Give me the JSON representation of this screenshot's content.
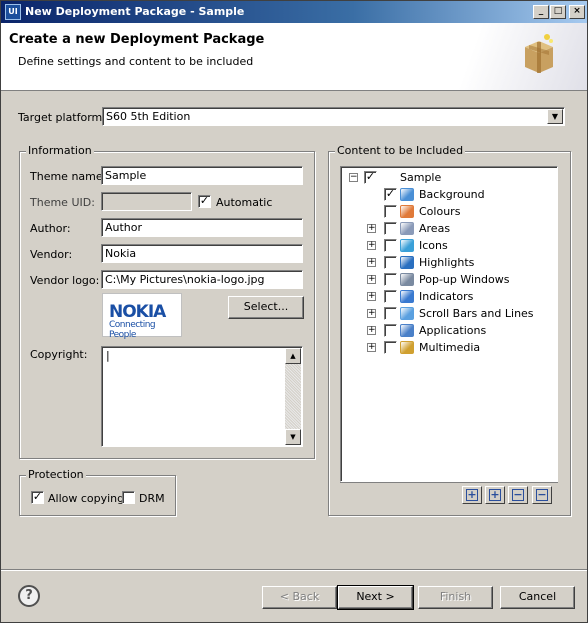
{
  "window": {
    "title": "New Deployment Package - Sample",
    "app_icon_text": "UI",
    "minimize_glyph": "_",
    "maximize_glyph": "□",
    "close_glyph": "×"
  },
  "banner": {
    "title": "Create a new Deployment Package",
    "subtitle": "Define settings and content to be included",
    "icon": "gift-box-icon"
  },
  "target_platform": {
    "label": "Target platform:",
    "value": "S60 5th Edition"
  },
  "information": {
    "group_label": "Information",
    "theme_name_label": "Theme name:",
    "theme_name_value": "Sample",
    "theme_uid_label": "Theme UID:",
    "theme_uid_value": "",
    "automatic_label": "Automatic",
    "automatic_checked": true,
    "author_label": "Author:",
    "author_value": "Author",
    "vendor_label": "Vendor:",
    "vendor_value": "Nokia",
    "vendor_logo_label": "Vendor logo:",
    "vendor_logo_value": "C:\\My Pictures\\nokia-logo.jpg",
    "logo_brand": "NOKIA",
    "logo_tagline": "Connecting People",
    "select_button": "Select...",
    "copyright_label": "Copyright:",
    "copyright_value": "|"
  },
  "protection": {
    "group_label": "Protection",
    "allow_copying_label": "Allow copying",
    "allow_copying_checked": true,
    "drm_label": "DRM",
    "drm_checked": false
  },
  "content": {
    "group_label": "Content to be Included",
    "root": {
      "label": "Sample",
      "checked": true,
      "expanded": true
    },
    "items": [
      {
        "label": "Background",
        "checked": true,
        "expandable": false,
        "icon": "background-icon",
        "color": "#4a8fd6"
      },
      {
        "label": "Colours",
        "checked": false,
        "expandable": false,
        "icon": "palette-icon",
        "color": "#e07a3a"
      },
      {
        "label": "Areas",
        "checked": false,
        "expandable": true,
        "icon": "areas-icon",
        "color": "#8a9ab8"
      },
      {
        "label": "Icons",
        "checked": false,
        "expandable": true,
        "icon": "icons-icon",
        "color": "#3aa0d8"
      },
      {
        "label": "Highlights",
        "checked": false,
        "expandable": true,
        "icon": "highlights-icon",
        "color": "#2a6fc0"
      },
      {
        "label": "Pop-up Windows",
        "checked": false,
        "expandable": true,
        "icon": "popup-icon",
        "color": "#7a8aa0"
      },
      {
        "label": "Indicators",
        "checked": false,
        "expandable": true,
        "icon": "indicators-icon",
        "color": "#3a7ad0"
      },
      {
        "label": "Scroll Bars and Lines",
        "checked": false,
        "expandable": true,
        "icon": "scrollbars-icon",
        "color": "#5aa0e0"
      },
      {
        "label": "Applications",
        "checked": false,
        "expandable": true,
        "icon": "applications-icon",
        "color": "#4a80c8"
      },
      {
        "label": "Multimedia",
        "checked": false,
        "expandable": true,
        "icon": "multimedia-icon",
        "color": "#d0a030"
      }
    ],
    "toolbar": [
      "+",
      "+",
      "−",
      "−"
    ]
  },
  "footer": {
    "help_glyph": "?",
    "back_label": "< Back",
    "next_label": "Next >",
    "finish_label": "Finish",
    "cancel_label": "Cancel"
  }
}
